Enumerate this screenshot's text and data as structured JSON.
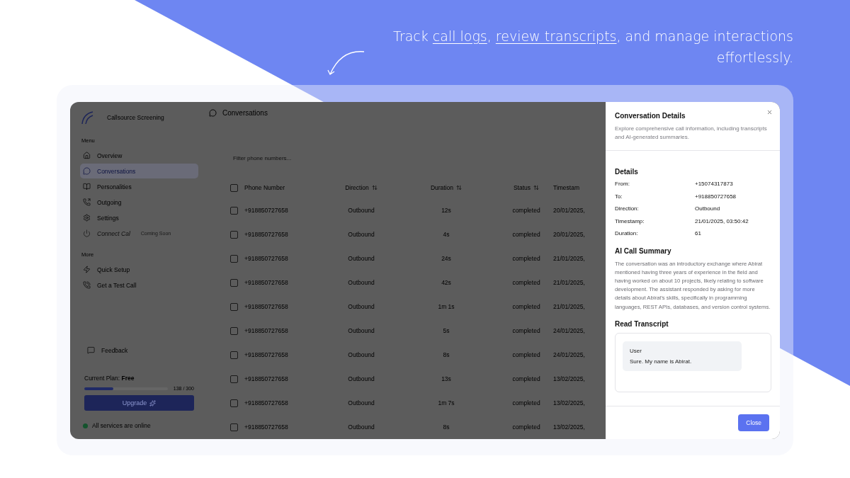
{
  "headline": {
    "segments": [
      {
        "text": "Track ",
        "underlined": false
      },
      {
        "text": "call logs",
        "underlined": true
      },
      {
        "text": ", ",
        "underlined": false
      },
      {
        "text": "review transcripts",
        "underlined": true
      },
      {
        "text": ", and manage interactions effortlessly.",
        "underlined": false
      }
    ]
  },
  "sidebar": {
    "brand": "Callsource Screening",
    "sections": [
      {
        "title": "Menu",
        "items": [
          {
            "label": "Overview",
            "selected": false,
            "disabled": false
          },
          {
            "label": "Conversations",
            "selected": true,
            "disabled": false
          },
          {
            "label": "Personalities",
            "selected": false,
            "disabled": false
          },
          {
            "label": "Outgoing",
            "selected": false,
            "disabled": false
          },
          {
            "label": "Settings",
            "selected": false,
            "disabled": false
          },
          {
            "label": "Connect Cal",
            "badge": "Coming Soon",
            "selected": false,
            "disabled": true
          }
        ]
      },
      {
        "title": "More",
        "items": [
          {
            "label": "Quick Setup",
            "selected": false,
            "disabled": false
          },
          {
            "label": "Get a Test Call",
            "selected": false,
            "disabled": false
          }
        ]
      }
    ],
    "feedback": "Feedback",
    "plan": {
      "label": "Current Plan:",
      "name": "Free",
      "usage": "138 / 300",
      "level": 0.35
    },
    "upgrade": "Upgrade",
    "status": "All services are online"
  },
  "main": {
    "title": "Conversations",
    "filter": {
      "placeholder": "Filter phone numbers..."
    },
    "columns": [
      {
        "label": "Phone Number",
        "sortable": false
      },
      {
        "label": "Direction",
        "sortable": true
      },
      {
        "label": "Duration",
        "sortable": true
      },
      {
        "label": "Status",
        "sortable": true
      },
      {
        "label": "Timestam",
        "sortable": false
      }
    ],
    "header_checked": false,
    "rows": [
      {
        "checked": false,
        "cells": [
          "+918850727658",
          "Outbound",
          "12s",
          "completed",
          "20/01/2025,"
        ]
      },
      {
        "checked": false,
        "cells": [
          "+918850727658",
          "Outbound",
          "4s",
          "completed",
          "20/01/2025,"
        ]
      },
      {
        "checked": false,
        "cells": [
          "+918850727658",
          "Outbound",
          "24s",
          "completed",
          "21/01/2025,"
        ]
      },
      {
        "checked": false,
        "cells": [
          "+918850727658",
          "Outbound",
          "42s",
          "completed",
          "21/01/2025,"
        ]
      },
      {
        "checked": false,
        "cells": [
          "+918850727658",
          "Outbound",
          "1m 1s",
          "completed",
          "21/01/2025,"
        ]
      },
      {
        "checked": false,
        "cells": [
          "+918850727658",
          "Outbound",
          "5s",
          "completed",
          "24/01/2025,"
        ]
      },
      {
        "checked": false,
        "cells": [
          "+918850727658",
          "Outbound",
          "8s",
          "completed",
          "24/01/2025,"
        ]
      },
      {
        "checked": false,
        "cells": [
          "+918850727658",
          "Outbound",
          "13s",
          "completed",
          "13/02/2025,"
        ]
      },
      {
        "checked": false,
        "cells": [
          "+918850727658",
          "Outbound",
          "1m 7s",
          "completed",
          "13/02/2025,"
        ]
      },
      {
        "checked": false,
        "cells": [
          "+918850727658",
          "Outbound",
          "8s",
          "completed",
          "13/02/2025,"
        ]
      }
    ]
  },
  "details": {
    "title": "Conversation Details",
    "description": "Explore comprehensive call information, including transcripts and AI-generated summaries.",
    "details_title": "Details",
    "fields": [
      {
        "label": "From:",
        "value": "+15074317873"
      },
      {
        "label": "To:",
        "value": "+918850727658"
      },
      {
        "label": "Direction:",
        "value": "Outbound"
      },
      {
        "label": "Timestamp:",
        "value": "21/01/2025, 03:50:42"
      },
      {
        "label": "Duration:",
        "value": "61"
      }
    ],
    "summary_title": "AI Call Summary",
    "summary": "The conversation was an introductory exchange where Abirat mentioned having three years of experience in the field and having worked on about 10 projects, likely relating to software development. The assistant responded by asking for more details about Abirat's skills, specifically in programming languages, REST APIs, databases, and version control systems.",
    "transcript_title": "Read Transcript",
    "transcript": [
      {
        "speaker": "User",
        "text": "Sure. My name is Abirat."
      }
    ],
    "close": "Close"
  }
}
